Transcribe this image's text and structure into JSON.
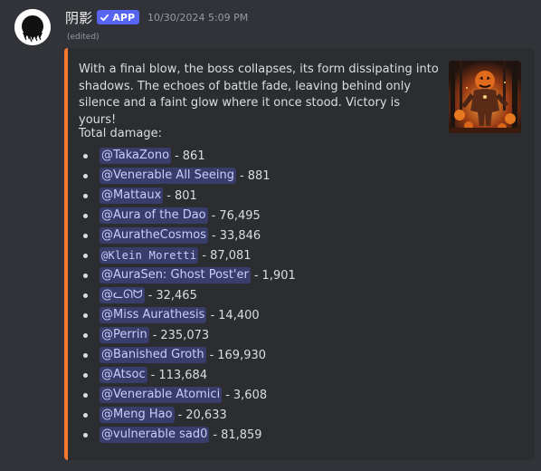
{
  "message": {
    "author": "阴影",
    "badge": "APP",
    "timestamp": "10/30/2024 5:09 PM",
    "edited": "(edited)"
  },
  "embed": {
    "accent_color": "#f57731",
    "description": "With a final blow, the boss collapses, its form dissipating into shadows. The echoes of battle fade, leaving behind only silence and a faint glow where it once stood. Victory is yours!",
    "damage_title": "Total damage:",
    "damage": [
      {
        "user": "@TakaZono",
        "value": "861"
      },
      {
        "user": "@Venerable All Seeing",
        "value": "881"
      },
      {
        "user": "@Mattaux",
        "value": "801"
      },
      {
        "user": "@Aura of the Dao",
        "value": "76,495"
      },
      {
        "user": "@AuratheCosmos",
        "value": "33,846"
      },
      {
        "user": "@Klein Moretti",
        "value": "87,081"
      },
      {
        "user": "@AuraSen: Ghost Post'er",
        "value": "1,901"
      },
      {
        "user": "@ᓚᘏᗢ",
        "value": "32,465"
      },
      {
        "user": "@Miss Aurathesis",
        "value": "14,400"
      },
      {
        "user": "@Perrin",
        "value": "235,073"
      },
      {
        "user": "@Banished Groth",
        "value": "169,930"
      },
      {
        "user": "@Atsoc",
        "value": "113,684"
      },
      {
        "user": "@Venerable Atomici",
        "value": "3,608"
      },
      {
        "user": "@Meng Hao",
        "value": "20,633"
      },
      {
        "user": "@vulnerable sad0",
        "value": "81,859"
      }
    ]
  }
}
